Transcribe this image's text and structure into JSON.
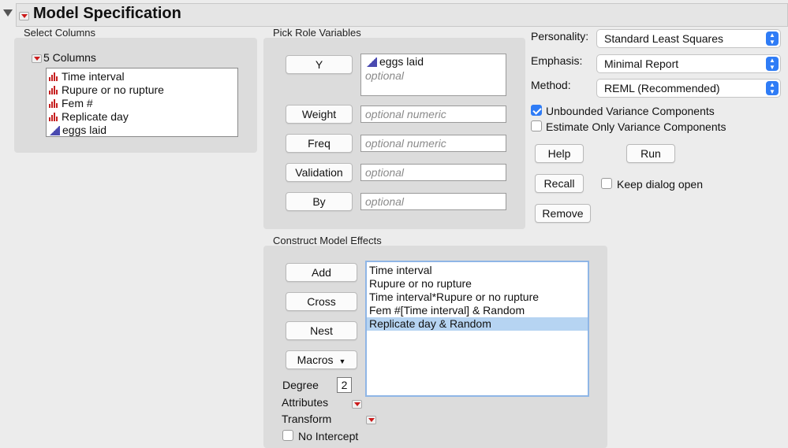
{
  "header": {
    "title": "Model Specification"
  },
  "select_columns": {
    "label": "Select Columns",
    "count_label": "5 Columns",
    "columns": [
      {
        "name": "Time interval",
        "type": "nominal"
      },
      {
        "name": "Rupure or no rupture",
        "type": "nominal"
      },
      {
        "name": "Fem #",
        "type": "nominal"
      },
      {
        "name": "Replicate day",
        "type": "nominal"
      },
      {
        "name": "eggs laid",
        "type": "continuous"
      }
    ]
  },
  "pick_roles": {
    "label": "Pick Role Variables",
    "y": {
      "button": "Y",
      "value": "eggs laid",
      "placeholder": "optional"
    },
    "weight": {
      "button": "Weight",
      "placeholder": "optional numeric"
    },
    "freq": {
      "button": "Freq",
      "placeholder": "optional numeric"
    },
    "validation": {
      "button": "Validation",
      "placeholder": "optional"
    },
    "by": {
      "button": "By",
      "placeholder": "optional"
    }
  },
  "options": {
    "personality": {
      "label": "Personality:",
      "value": "Standard Least Squares"
    },
    "emphasis": {
      "label": "Emphasis:",
      "value": "Minimal Report"
    },
    "method": {
      "label": "Method:",
      "value": "REML (Recommended)"
    },
    "unbounded": {
      "label": "Unbounded Variance Components",
      "checked": true
    },
    "estimate_only": {
      "label": "Estimate Only Variance Components",
      "checked": false
    },
    "keep_open": {
      "label": "Keep dialog open",
      "checked": false
    }
  },
  "actions": {
    "help": "Help",
    "run": "Run",
    "recall": "Recall",
    "remove": "Remove"
  },
  "construct": {
    "label": "Construct Model Effects",
    "add": "Add",
    "cross": "Cross",
    "nest": "Nest",
    "macros": "Macros",
    "degree_label": "Degree",
    "degree_value": "2",
    "attributes": "Attributes",
    "transform": "Transform",
    "no_intercept": {
      "label": "No Intercept",
      "checked": false
    },
    "effects": [
      "Time interval",
      "Rupure or no rupture",
      "Time interval*Rupure or no rupture",
      "Fem #[Time interval] & Random",
      "Replicate day & Random"
    ],
    "selected_index": 4
  },
  "colors": {
    "accent": "#2f7cf6",
    "selection": "#b6d4f2",
    "red": "#cc1a1a"
  },
  "icons": {
    "disclosure": "disclosure-triangle-icon",
    "menu": "red-triangle-menu-icon",
    "nominal": "bar-chart-icon",
    "continuous": "continuous-triangle-icon"
  }
}
